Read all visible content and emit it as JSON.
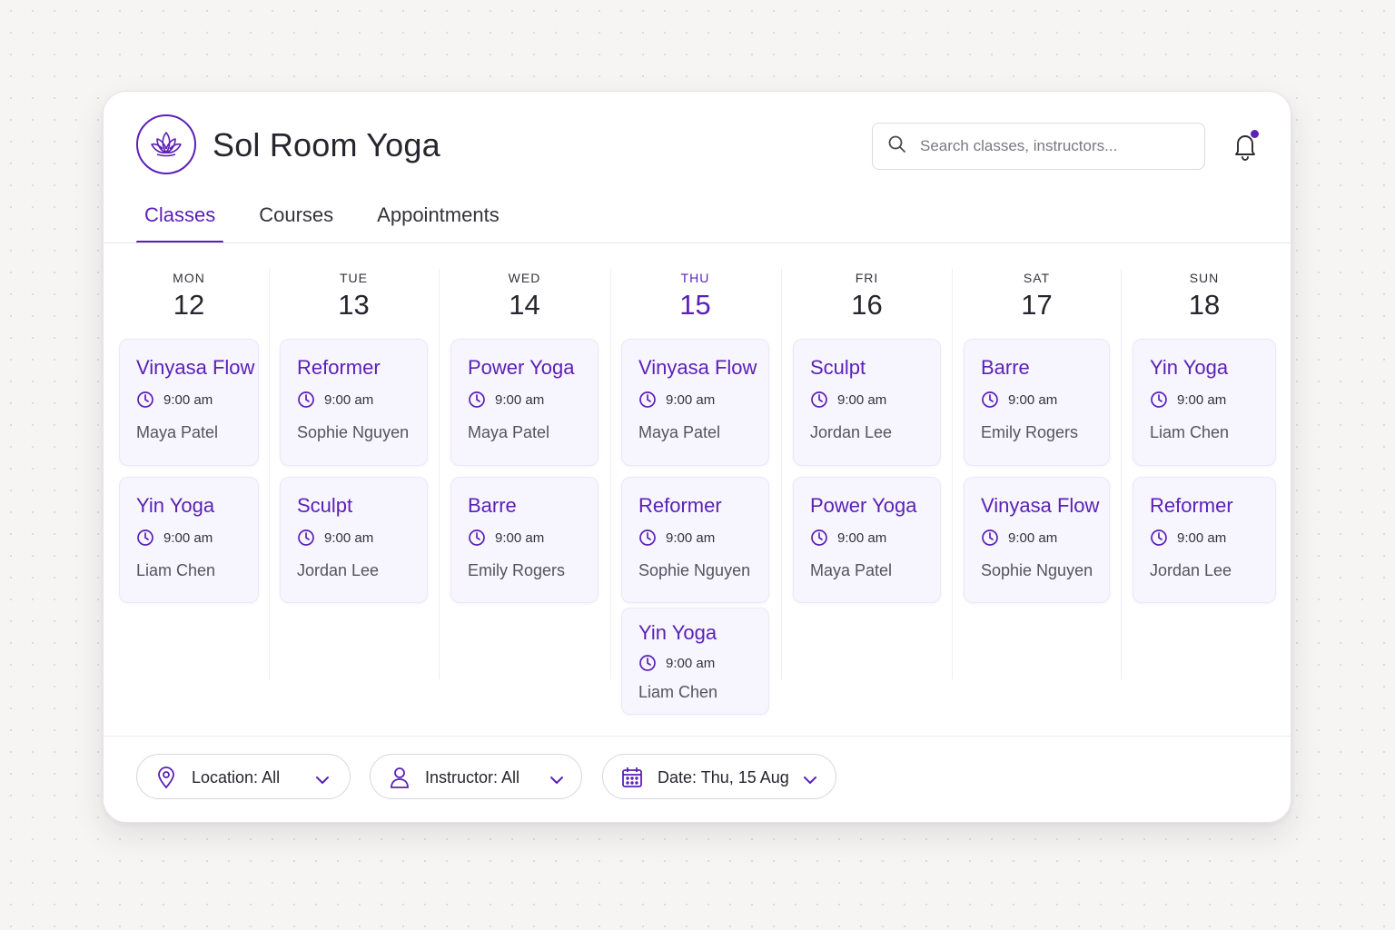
{
  "brand": {
    "name": "Sol Room Yoga",
    "logo_icon": "lotus-icon"
  },
  "search": {
    "placeholder": "Search classes, instructors..."
  },
  "notifications": {
    "icon": "bell-icon",
    "has_unread": true
  },
  "tabs": [
    {
      "label": "Classes",
      "active": true
    },
    {
      "label": "Courses",
      "active": false
    },
    {
      "label": "Appointments",
      "active": false
    }
  ],
  "week": [
    {
      "dow": "MON",
      "date": "12",
      "today": false,
      "classes": [
        {
          "title": "Vinyasa Flow",
          "time": "9:00 am",
          "instructor": "Maya Patel"
        },
        {
          "title": "Yin Yoga",
          "time": "9:00 am",
          "instructor": "Liam Chen"
        }
      ]
    },
    {
      "dow": "TUE",
      "date": "13",
      "today": false,
      "classes": [
        {
          "title": "Reformer",
          "time": "9:00 am",
          "instructor": "Sophie Nguyen"
        },
        {
          "title": "Sculpt",
          "time": "9:00 am",
          "instructor": "Jordan Lee"
        }
      ]
    },
    {
      "dow": "WED",
      "date": "14",
      "today": false,
      "classes": [
        {
          "title": "Power Yoga",
          "time": "9:00 am",
          "instructor": "Maya Patel"
        },
        {
          "title": "Barre",
          "time": "9:00 am",
          "instructor": "Emily Rogers"
        }
      ]
    },
    {
      "dow": "THU",
      "date": "15",
      "today": true,
      "classes": [
        {
          "title": "Vinyasa Flow",
          "time": "9:00 am",
          "instructor": "Maya Patel"
        },
        {
          "title": "Reformer",
          "time": "9:00 am",
          "instructor": "Sophie Nguyen"
        },
        {
          "title": "Yin Yoga",
          "time": "9:00 am",
          "instructor": "Liam Chen"
        }
      ]
    },
    {
      "dow": "FRI",
      "date": "16",
      "today": false,
      "classes": [
        {
          "title": "Sculpt",
          "time": "9:00 am",
          "instructor": "Jordan Lee"
        },
        {
          "title": "Power Yoga",
          "time": "9:00 am",
          "instructor": "Maya Patel"
        }
      ]
    },
    {
      "dow": "SAT",
      "date": "17",
      "today": false,
      "classes": [
        {
          "title": "Barre",
          "time": "9:00 am",
          "instructor": "Emily Rogers"
        },
        {
          "title": "Vinyasa Flow",
          "time": "9:00 am",
          "instructor": "Sophie Nguyen"
        }
      ]
    },
    {
      "dow": "SUN",
      "date": "18",
      "today": false,
      "classes": [
        {
          "title": "Yin Yoga",
          "time": "9:00 am",
          "instructor": "Liam Chen"
        },
        {
          "title": "Reformer",
          "time": "9:00 am",
          "instructor": "Jordan Lee"
        }
      ]
    }
  ],
  "filters": {
    "location": {
      "label": "Location: All",
      "icon": "map-pin-icon"
    },
    "instructor": {
      "label": "Instructor: All",
      "icon": "user-icon"
    },
    "date": {
      "label": "Date: Thu, 15 Aug",
      "icon": "calendar-icon"
    }
  },
  "colors": {
    "accent": "#5b21b6",
    "card_bg": "#f7f5fe"
  }
}
